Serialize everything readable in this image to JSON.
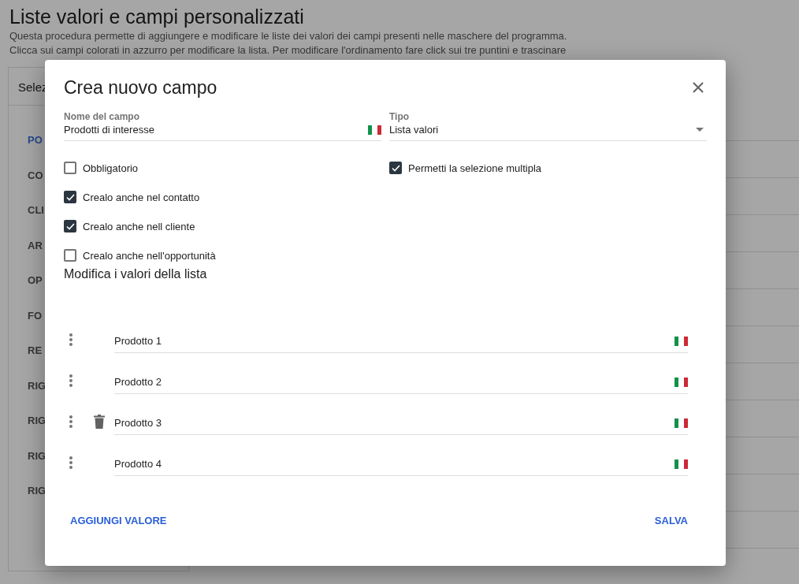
{
  "page": {
    "title": "Liste valori e campi personalizzati",
    "description": [
      "Questa procedura permette di aggiungere e modificare le liste dei valori dei campi presenti nelle maschere del programma.",
      "Clicca sui campi colorati in azzurro per modificare la lista. Per modificare l'ordinamento fare click sui tre puntini e trascinare"
    ]
  },
  "sidebar": {
    "header": "Selez",
    "items": [
      {
        "label": "PO",
        "selected": true
      },
      {
        "label": "CO",
        "selected": false
      },
      {
        "label": "CLI",
        "selected": false
      },
      {
        "label": "AR",
        "selected": false
      },
      {
        "label": "OP",
        "selected": false
      },
      {
        "label": "FO",
        "selected": false
      },
      {
        "label": "RE",
        "selected": false
      },
      {
        "label": "RIG",
        "selected": false
      },
      {
        "label": "RIG",
        "selected": false
      },
      {
        "label": "RIG",
        "selected": false
      },
      {
        "label": "RIG",
        "selected": false
      }
    ]
  },
  "dialog": {
    "title": "Crea nuovo campo",
    "name_field": {
      "label": "Nome del campo",
      "value": "Prodotti di interesse"
    },
    "type_field": {
      "label": "Tipo",
      "value": "Lista valori"
    },
    "checkboxes_left": [
      {
        "label": "Obbligatorio",
        "checked": false
      },
      {
        "label": "Crealo anche nel contatto",
        "checked": true
      },
      {
        "label": "Crealo anche nell cliente",
        "checked": true
      },
      {
        "label": "Crealo anche nell'opportunità",
        "checked": false
      }
    ],
    "checkboxes_right": [
      {
        "label": "Permetti la selezione multipla",
        "checked": true
      }
    ],
    "values_heading": "Modifica i valori della lista",
    "values": [
      {
        "value": "Prodotto 1",
        "hovered": false
      },
      {
        "value": "Prodotto 2",
        "hovered": false
      },
      {
        "value": "Prodotto 3",
        "hovered": true
      },
      {
        "value": "Prodotto 4",
        "hovered": false
      }
    ],
    "buttons": {
      "add": "AGGIUNGI VALORE",
      "save": "SALVA"
    }
  }
}
